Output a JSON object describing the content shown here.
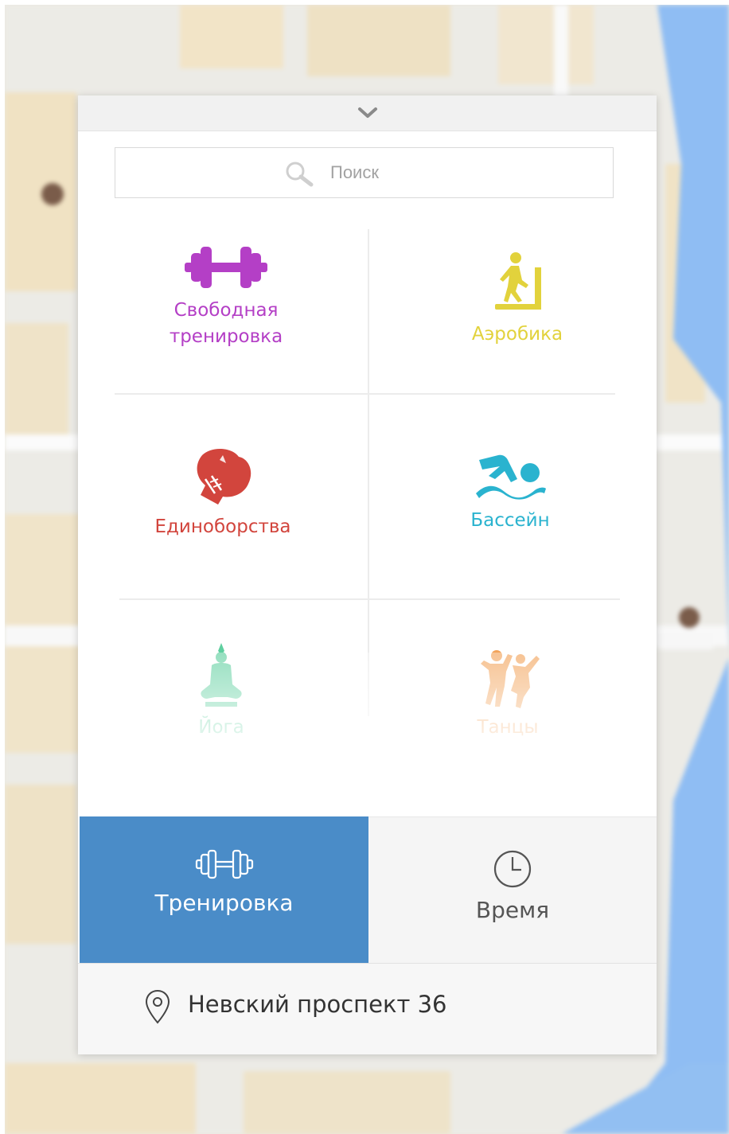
{
  "map": {
    "colors": {
      "land": "#ece9e2",
      "block": "#f1e3c6",
      "road": "#ffffff",
      "water": "#8fbdf3"
    }
  },
  "panel": {
    "collapse_icon": "chevron-down-icon",
    "search": {
      "placeholder": "Поиск",
      "value": "",
      "icon": "search-icon"
    },
    "categories": [
      {
        "label": "Свободная тренировка",
        "color": "#b43fc6",
        "icon": "dumbbell-icon"
      },
      {
        "label": "Аэробика",
        "color": "#e2d23c",
        "icon": "treadmill-icon"
      },
      {
        "label": "Единоборства",
        "color": "#d2453d",
        "icon": "boxing-glove-icon"
      },
      {
        "label": "Бассейн",
        "color": "#2ab3cf",
        "icon": "swimmer-icon"
      },
      {
        "label": "Йога",
        "color": "#5fcf9f",
        "icon": "yoga-icon"
      },
      {
        "label": "Танцы",
        "color": "#f2a35a",
        "icon": "dancers-icon"
      }
    ],
    "tabs": [
      {
        "label": "Тренировка",
        "icon": "dumbbell-outline-icon",
        "active": true,
        "bg": "#4a8cc8"
      },
      {
        "label": "Время",
        "icon": "clock-icon",
        "active": false,
        "bg": "#f5f5f5"
      }
    ],
    "address": {
      "text": "Невский проспект 36",
      "icon": "location-pin-icon"
    }
  }
}
